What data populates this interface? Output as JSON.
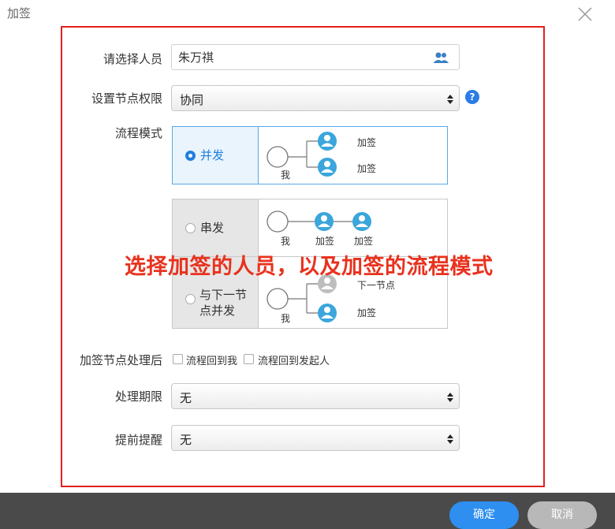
{
  "dialog": {
    "title": "加签"
  },
  "form": {
    "person_label": "请选择人员",
    "person_value": "朱万祺",
    "permission_label": "设置节点权限",
    "permission_value": "协同",
    "mode_label": "流程模式",
    "after_label": "加签节点处理后",
    "after_options": [
      "流程回到我",
      "流程回到发起人"
    ],
    "deadline_label": "处理期限",
    "deadline_value": "无",
    "reminder_label": "提前提醒",
    "reminder_value": "无"
  },
  "modes": {
    "parallel": {
      "label": "并发",
      "me": "我",
      "node1": "加签",
      "node2": "加签"
    },
    "serial": {
      "label": "串发",
      "me": "我",
      "node1": "加签",
      "node2": "加签"
    },
    "next": {
      "label_line1": "与下一节",
      "label_line2": "点并发",
      "me": "我",
      "node1": "下一节点",
      "node2": "加签"
    }
  },
  "annotation": "选择加签的人员，以及加签的流程模式",
  "footer": {
    "ok": "确定",
    "cancel": "取消"
  },
  "colors": {
    "accent": "#2e8ff0",
    "node": "#3aa6dc",
    "highlight": "#e02020"
  },
  "icons": {
    "close": "close-icon",
    "picker": "users-icon",
    "help": "help-icon",
    "select": "updown-arrows-icon"
  }
}
